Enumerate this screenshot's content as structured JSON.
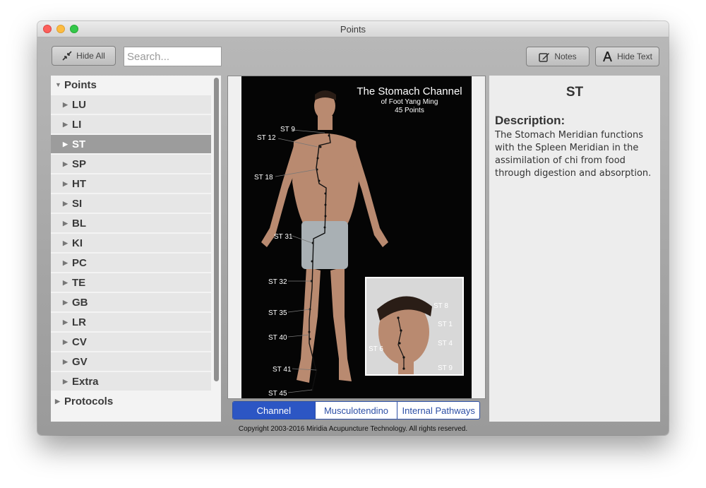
{
  "window": {
    "title": "Points"
  },
  "toolbar": {
    "hide_all_label": "Hide All",
    "search_placeholder": "Search...",
    "notes_label": "Notes",
    "hide_text_label": "Hide Text"
  },
  "sidebar": {
    "points_label": "Points",
    "items": [
      "LU",
      "LI",
      "ST",
      "SP",
      "HT",
      "SI",
      "BL",
      "KI",
      "PC",
      "TE",
      "GB",
      "LR",
      "CV",
      "GV",
      "Extra"
    ],
    "selected": "ST",
    "protocols_label": "Protocols"
  },
  "image": {
    "title": "The Stomach Channel",
    "subtitle": "of Foot Yang Ming",
    "count": "45 Points",
    "body_labels": [
      "ST 9",
      "ST 12",
      "ST 18",
      "ST 31",
      "ST 32",
      "ST 35",
      "ST 40",
      "ST 41",
      "ST 45"
    ],
    "inset_labels": [
      "ST 8",
      "ST 1",
      "ST 4",
      "ST 6",
      "ST 9"
    ]
  },
  "view_tabs": {
    "items": [
      "Channel",
      "Musculotendino",
      "Internal Pathways"
    ],
    "active": "Channel"
  },
  "description": {
    "title": "ST",
    "heading": "Description:",
    "body": "The Stomach Meridian functions with the Spleen Meridian in the assimilation of chi from food through digestion and absorption."
  },
  "footer": {
    "copyright": "Copyright 2003-2016 Miridia Acupuncture Technology.  All rights reserved."
  },
  "colors": {
    "accent": "#2c56c4",
    "selected_row": "#9c9c9c",
    "meridian_line": "#111111"
  }
}
